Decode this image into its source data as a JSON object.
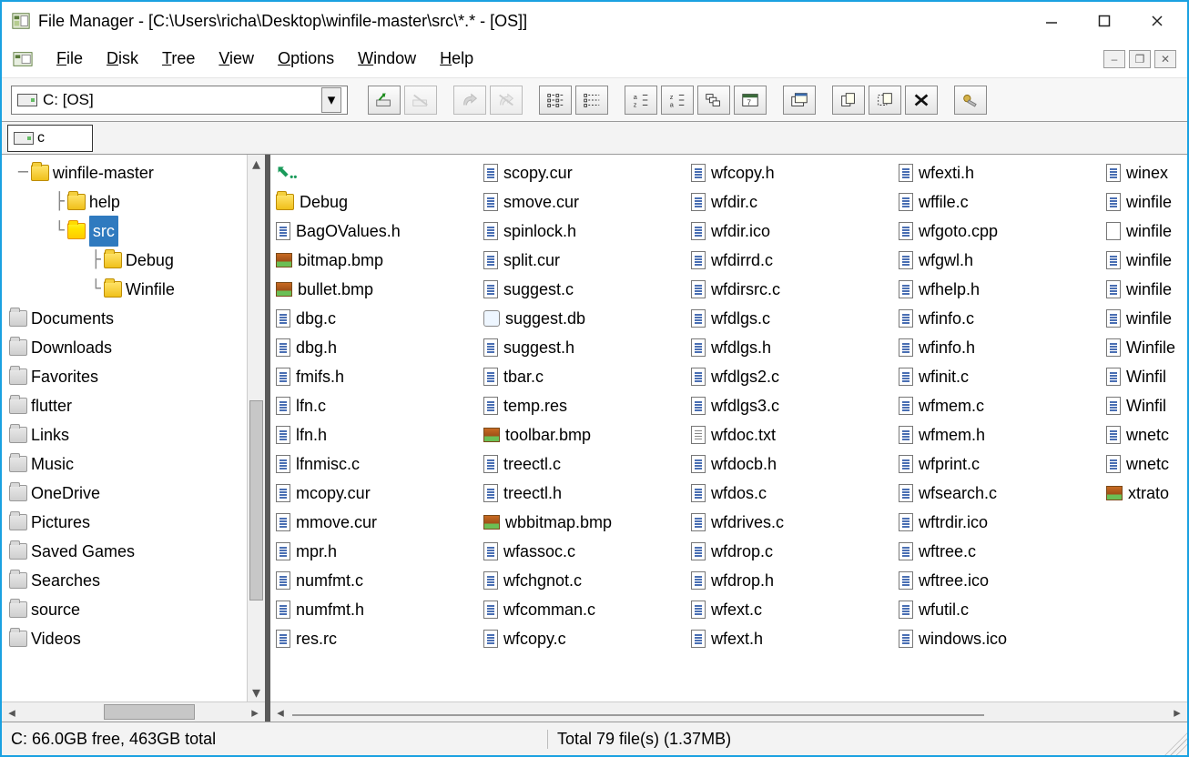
{
  "window": {
    "title": "File Manager - [C:\\Users\\richa\\Desktop\\winfile-master\\src\\*.* - [OS]]"
  },
  "menu": {
    "file": "File",
    "disk": "Disk",
    "tree": "Tree",
    "view": "View",
    "options": "Options",
    "window": "Window",
    "help": "Help"
  },
  "drive_combo": "C: [OS]",
  "path_box": "c",
  "tree": {
    "items": [
      {
        "indent": 0,
        "prefix": "─ ",
        "icon": "folder",
        "label": "winfile-master",
        "sel": false
      },
      {
        "indent": 1,
        "prefix": "├ ",
        "icon": "folder",
        "label": "help",
        "sel": false
      },
      {
        "indent": 1,
        "prefix": "└ ",
        "icon": "folder-open",
        "label": "src",
        "sel": true
      },
      {
        "indent": 2,
        "prefix": "├ ",
        "icon": "folder",
        "label": "Debug",
        "sel": false
      },
      {
        "indent": 2,
        "prefix": "└ ",
        "icon": "folder",
        "label": "Winfile",
        "sel": false
      },
      {
        "indent": -1,
        "icon": "folder-closed",
        "label": "Documents"
      },
      {
        "indent": -1,
        "icon": "folder-closed",
        "label": "Downloads"
      },
      {
        "indent": -1,
        "icon": "folder-closed",
        "label": "Favorites"
      },
      {
        "indent": -1,
        "icon": "folder-closed",
        "label": "flutter"
      },
      {
        "indent": -1,
        "icon": "folder-closed",
        "label": "Links"
      },
      {
        "indent": -1,
        "icon": "folder-closed",
        "label": "Music"
      },
      {
        "indent": -1,
        "icon": "folder-closed",
        "label": "OneDrive"
      },
      {
        "indent": -1,
        "icon": "folder-closed",
        "label": "Pictures"
      },
      {
        "indent": -1,
        "icon": "folder-closed",
        "label": "Saved Games"
      },
      {
        "indent": -1,
        "icon": "folder-closed",
        "label": "Searches"
      },
      {
        "indent": -1,
        "icon": "folder-closed",
        "label": "source"
      },
      {
        "indent": -1,
        "icon": "folder-closed",
        "label": "Videos"
      }
    ]
  },
  "files": {
    "columns": [
      [
        {
          "icon": "up",
          "label": ".."
        },
        {
          "icon": "folder",
          "label": "Debug"
        },
        {
          "icon": "doc",
          "label": "BagOValues.h"
        },
        {
          "icon": "bmp",
          "label": "bitmap.bmp"
        },
        {
          "icon": "bmp",
          "label": "bullet.bmp"
        },
        {
          "icon": "doc",
          "label": "dbg.c"
        },
        {
          "icon": "doc",
          "label": "dbg.h"
        },
        {
          "icon": "doc",
          "label": "fmifs.h"
        },
        {
          "icon": "doc",
          "label": "lfn.c"
        },
        {
          "icon": "doc",
          "label": "lfn.h"
        },
        {
          "icon": "doc",
          "label": "lfnmisc.c"
        },
        {
          "icon": "doc",
          "label": "mcopy.cur"
        },
        {
          "icon": "doc",
          "label": "mmove.cur"
        },
        {
          "icon": "doc",
          "label": "mpr.h"
        },
        {
          "icon": "doc",
          "label": "numfmt.c"
        },
        {
          "icon": "doc",
          "label": "numfmt.h"
        },
        {
          "icon": "doc",
          "label": "res.rc"
        }
      ],
      [
        {
          "icon": "doc",
          "label": "scopy.cur"
        },
        {
          "icon": "doc",
          "label": "smove.cur"
        },
        {
          "icon": "doc",
          "label": "spinlock.h"
        },
        {
          "icon": "doc",
          "label": "split.cur"
        },
        {
          "icon": "doc",
          "label": "suggest.c"
        },
        {
          "icon": "db",
          "label": "suggest.db"
        },
        {
          "icon": "doc",
          "label": "suggest.h"
        },
        {
          "icon": "doc",
          "label": "tbar.c"
        },
        {
          "icon": "doc",
          "label": "temp.res"
        },
        {
          "icon": "bmp",
          "label": "toolbar.bmp"
        },
        {
          "icon": "doc",
          "label": "treectl.c"
        },
        {
          "icon": "doc",
          "label": "treectl.h"
        },
        {
          "icon": "bmp",
          "label": "wbbitmap.bmp"
        },
        {
          "icon": "doc",
          "label": "wfassoc.c"
        },
        {
          "icon": "doc",
          "label": "wfchgnot.c"
        },
        {
          "icon": "doc",
          "label": "wfcomman.c"
        },
        {
          "icon": "doc",
          "label": "wfcopy.c"
        }
      ],
      [
        {
          "icon": "doc",
          "label": "wfcopy.h"
        },
        {
          "icon": "doc",
          "label": "wfdir.c"
        },
        {
          "icon": "doc",
          "label": "wfdir.ico"
        },
        {
          "icon": "doc",
          "label": "wfdirrd.c"
        },
        {
          "icon": "doc",
          "label": "wfdirsrc.c"
        },
        {
          "icon": "doc",
          "label": "wfdlgs.c"
        },
        {
          "icon": "doc",
          "label": "wfdlgs.h"
        },
        {
          "icon": "doc",
          "label": "wfdlgs2.c"
        },
        {
          "icon": "doc",
          "label": "wfdlgs3.c"
        },
        {
          "icon": "txt",
          "label": "wfdoc.txt"
        },
        {
          "icon": "doc",
          "label": "wfdocb.h"
        },
        {
          "icon": "doc",
          "label": "wfdos.c"
        },
        {
          "icon": "doc",
          "label": "wfdrives.c"
        },
        {
          "icon": "doc",
          "label": "wfdrop.c"
        },
        {
          "icon": "doc",
          "label": "wfdrop.h"
        },
        {
          "icon": "doc",
          "label": "wfext.c"
        },
        {
          "icon": "doc",
          "label": "wfext.h"
        }
      ],
      [
        {
          "icon": "doc",
          "label": "wfexti.h"
        },
        {
          "icon": "doc",
          "label": "wffile.c"
        },
        {
          "icon": "doc",
          "label": "wfgoto.cpp"
        },
        {
          "icon": "doc",
          "label": "wfgwl.h"
        },
        {
          "icon": "doc",
          "label": "wfhelp.h"
        },
        {
          "icon": "doc",
          "label": "wfinfo.c"
        },
        {
          "icon": "doc",
          "label": "wfinfo.h"
        },
        {
          "icon": "doc",
          "label": "wfinit.c"
        },
        {
          "icon": "doc",
          "label": "wfmem.c"
        },
        {
          "icon": "doc",
          "label": "wfmem.h"
        },
        {
          "icon": "doc",
          "label": "wfprint.c"
        },
        {
          "icon": "doc",
          "label": "wfsearch.c"
        },
        {
          "icon": "doc",
          "label": "wftrdir.ico"
        },
        {
          "icon": "doc",
          "label": "wftree.c"
        },
        {
          "icon": "doc",
          "label": "wftree.ico"
        },
        {
          "icon": "doc",
          "label": "wfutil.c"
        },
        {
          "icon": "doc",
          "label": "windows.ico"
        }
      ],
      [
        {
          "icon": "doc",
          "label": "winex"
        },
        {
          "icon": "doc",
          "label": "winfile"
        },
        {
          "icon": "blank",
          "label": "winfile"
        },
        {
          "icon": "doc",
          "label": "winfile"
        },
        {
          "icon": "doc",
          "label": "winfile"
        },
        {
          "icon": "doc",
          "label": "winfile"
        },
        {
          "icon": "doc",
          "label": "Winfile"
        },
        {
          "icon": "doc",
          "label": "Winfil"
        },
        {
          "icon": "doc",
          "label": "Winfil"
        },
        {
          "icon": "doc",
          "label": "wnetc"
        },
        {
          "icon": "doc",
          "label": "wnetc"
        },
        {
          "icon": "bmp",
          "label": "xtrato"
        }
      ]
    ]
  },
  "status": {
    "left": "C: 66.0GB free,  463GB total",
    "right": "Total 79 file(s) (1.37MB)"
  },
  "toolbar_buttons": [
    "connect-drive",
    "disconnect-drive",
    "sep",
    "share",
    "stop-share",
    "sep",
    "view-name",
    "view-details",
    "sep",
    "sort-name",
    "sort-type",
    "sort-size",
    "sort-date",
    "sep",
    "new-window",
    "sep",
    "copy",
    "move",
    "delete",
    "sep",
    "permissions"
  ]
}
